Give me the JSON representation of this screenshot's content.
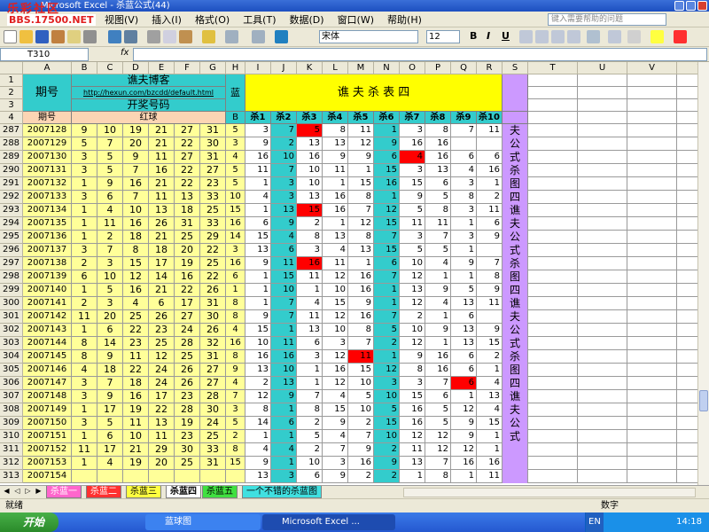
{
  "app": {
    "title": "Microsoft Excel - 杀蓝公式(44)",
    "watermark1": "乐彩社区",
    "watermark2": "BBS.17500.NET"
  },
  "menu": [
    "视图(V)",
    "插入(I)",
    "格式(O)",
    "工具(T)",
    "数据(D)",
    "窗口(W)",
    "帮助(H)"
  ],
  "help_placeholder": "键入需要帮助的问题",
  "toolbar": {
    "font": "宋体",
    "size": "12",
    "bold": "B",
    "italic": "I",
    "underline": "U"
  },
  "formula": {
    "cell_ref": "T310",
    "fx": "fx"
  },
  "columns": [
    "A",
    "B",
    "C",
    "D",
    "E",
    "F",
    "G",
    "H",
    "I",
    "J",
    "K",
    "L",
    "M",
    "N",
    "O",
    "P",
    "Q",
    "R",
    "S",
    "T",
    "U",
    "V",
    "W"
  ],
  "header": {
    "period": "期号",
    "blog": "谯夫博客",
    "url": "http://hexun.com/bzcdd/default.html",
    "draw": "开奖号码",
    "red": "红球",
    "blue_label": "蓝号",
    "blue_b": "B",
    "table_title": "谯 夫 杀 表 四",
    "kill_headers": [
      "杀1",
      "杀2",
      "杀3",
      "杀4",
      "杀5",
      "杀6",
      "杀7",
      "杀8",
      "杀9",
      "杀10"
    ]
  },
  "rows": [
    {
      "n": "287",
      "id": "2007128",
      "r": [
        "9",
        "10",
        "19",
        "21",
        "27",
        "31"
      ],
      "b": "5",
      "k": [
        "3",
        "7",
        "5",
        "8",
        "11",
        "1",
        "3",
        "8",
        "7",
        "11"
      ]
    },
    {
      "n": "288",
      "id": "2007129",
      "r": [
        "5",
        "7",
        "20",
        "21",
        "22",
        "30"
      ],
      "b": "3",
      "k": [
        "9",
        "2",
        "13",
        "13",
        "12",
        "9",
        "16",
        "16",
        "",
        ""
      ]
    },
    {
      "n": "289",
      "id": "2007130",
      "r": [
        "3",
        "5",
        "9",
        "11",
        "27",
        "31"
      ],
      "b": "4",
      "k": [
        "16",
        "10",
        "16",
        "9",
        "9",
        "6",
        "4",
        "16",
        "6",
        "6"
      ]
    },
    {
      "n": "290",
      "id": "2007131",
      "r": [
        "3",
        "5",
        "7",
        "16",
        "22",
        "27"
      ],
      "b": "5",
      "k": [
        "11",
        "7",
        "10",
        "11",
        "1",
        "15",
        "3",
        "13",
        "4",
        "16"
      ]
    },
    {
      "n": "291",
      "id": "2007132",
      "r": [
        "1",
        "9",
        "16",
        "21",
        "22",
        "23"
      ],
      "b": "5",
      "k": [
        "1",
        "3",
        "10",
        "1",
        "15",
        "16",
        "15",
        "6",
        "3",
        "1"
      ]
    },
    {
      "n": "292",
      "id": "2007133",
      "r": [
        "3",
        "6",
        "7",
        "11",
        "13",
        "33"
      ],
      "b": "10",
      "k": [
        "4",
        "3",
        "13",
        "16",
        "8",
        "1",
        "9",
        "5",
        "8",
        "2"
      ]
    },
    {
      "n": "293",
      "id": "2007134",
      "r": [
        "1",
        "4",
        "10",
        "13",
        "18",
        "25"
      ],
      "b": "15",
      "k": [
        "1",
        "13",
        "15",
        "16",
        "7",
        "12",
        "5",
        "8",
        "3",
        "11"
      ]
    },
    {
      "n": "294",
      "id": "2007135",
      "r": [
        "1",
        "11",
        "16",
        "26",
        "31",
        "33"
      ],
      "b": "16",
      "k": [
        "6",
        "9",
        "2",
        "1",
        "12",
        "15",
        "11",
        "11",
        "1",
        "6"
      ]
    },
    {
      "n": "295",
      "id": "2007136",
      "r": [
        "1",
        "2",
        "18",
        "21",
        "25",
        "29"
      ],
      "b": "14",
      "k": [
        "15",
        "4",
        "8",
        "13",
        "8",
        "7",
        "3",
        "7",
        "3",
        "9"
      ]
    },
    {
      "n": "296",
      "id": "2007137",
      "r": [
        "3",
        "7",
        "8",
        "18",
        "20",
        "22"
      ],
      "b": "3",
      "k": [
        "13",
        "6",
        "3",
        "4",
        "13",
        "15",
        "5",
        "5",
        "1",
        ""
      ]
    },
    {
      "n": "297",
      "id": "2007138",
      "r": [
        "2",
        "3",
        "15",
        "17",
        "19",
        "25"
      ],
      "b": "16",
      "k": [
        "9",
        "11",
        "16",
        "11",
        "1",
        "6",
        "10",
        "4",
        "9",
        "7"
      ]
    },
    {
      "n": "298",
      "id": "2007139",
      "r": [
        "6",
        "10",
        "12",
        "14",
        "16",
        "22"
      ],
      "b": "6",
      "k": [
        "1",
        "15",
        "11",
        "12",
        "16",
        "7",
        "12",
        "1",
        "1",
        "8"
      ]
    },
    {
      "n": "299",
      "id": "2007140",
      "r": [
        "1",
        "5",
        "16",
        "21",
        "22",
        "26"
      ],
      "b": "1",
      "k": [
        "1",
        "10",
        "1",
        "10",
        "16",
        "1",
        "13",
        "9",
        "5",
        "9"
      ]
    },
    {
      "n": "300",
      "id": "2007141",
      "r": [
        "2",
        "3",
        "4",
        "6",
        "17",
        "31"
      ],
      "b": "8",
      "k": [
        "1",
        "7",
        "4",
        "15",
        "9",
        "1",
        "12",
        "4",
        "13",
        "11"
      ]
    },
    {
      "n": "301",
      "id": "2007142",
      "r": [
        "11",
        "20",
        "25",
        "26",
        "27",
        "30"
      ],
      "b": "8",
      "k": [
        "9",
        "7",
        "11",
        "12",
        "16",
        "7",
        "2",
        "1",
        "6",
        ""
      ]
    },
    {
      "n": "302",
      "id": "2007143",
      "r": [
        "1",
        "6",
        "22",
        "23",
        "24",
        "26"
      ],
      "b": "4",
      "k": [
        "15",
        "1",
        "13",
        "10",
        "8",
        "5",
        "10",
        "9",
        "13",
        "9"
      ]
    },
    {
      "n": "303",
      "id": "2007144",
      "r": [
        "8",
        "14",
        "23",
        "25",
        "28",
        "32"
      ],
      "b": "16",
      "k": [
        "10",
        "11",
        "6",
        "3",
        "7",
        "2",
        "12",
        "1",
        "13",
        "15"
      ]
    },
    {
      "n": "304",
      "id": "2007145",
      "r": [
        "8",
        "9",
        "11",
        "12",
        "25",
        "31"
      ],
      "b": "8",
      "k": [
        "16",
        "16",
        "3",
        "12",
        "11",
        "1",
        "9",
        "16",
        "6",
        "2"
      ]
    },
    {
      "n": "305",
      "id": "2007146",
      "r": [
        "4",
        "18",
        "22",
        "24",
        "26",
        "27"
      ],
      "b": "9",
      "k": [
        "13",
        "10",
        "1",
        "16",
        "15",
        "12",
        "8",
        "16",
        "6",
        "1"
      ]
    },
    {
      "n": "306",
      "id": "2007147",
      "r": [
        "3",
        "7",
        "18",
        "24",
        "26",
        "27"
      ],
      "b": "4",
      "k": [
        "2",
        "13",
        "1",
        "12",
        "10",
        "3",
        "3",
        "7",
        "6",
        "4"
      ]
    },
    {
      "n": "307",
      "id": "2007148",
      "r": [
        "3",
        "9",
        "16",
        "17",
        "23",
        "28"
      ],
      "b": "7",
      "k": [
        "12",
        "9",
        "7",
        "4",
        "5",
        "10",
        "15",
        "6",
        "1",
        "13"
      ]
    },
    {
      "n": "308",
      "id": "2007149",
      "r": [
        "1",
        "17",
        "19",
        "22",
        "28",
        "30"
      ],
      "b": "3",
      "k": [
        "8",
        "1",
        "8",
        "15",
        "10",
        "5",
        "16",
        "5",
        "12",
        "4"
      ]
    },
    {
      "n": "309",
      "id": "2007150",
      "r": [
        "3",
        "5",
        "11",
        "13",
        "19",
        "24"
      ],
      "b": "5",
      "k": [
        "14",
        "6",
        "2",
        "9",
        "2",
        "15",
        "16",
        "5",
        "9",
        "15"
      ]
    },
    {
      "n": "310",
      "id": "2007151",
      "r": [
        "1",
        "6",
        "10",
        "11",
        "23",
        "25"
      ],
      "b": "2",
      "k": [
        "1",
        "1",
        "5",
        "4",
        "7",
        "10",
        "12",
        "12",
        "9",
        "1"
      ]
    },
    {
      "n": "311",
      "id": "2007152",
      "r": [
        "11",
        "17",
        "21",
        "29",
        "30",
        "33"
      ],
      "b": "8",
      "k": [
        "4",
        "4",
        "2",
        "7",
        "9",
        "2",
        "11",
        "12",
        "12",
        "1"
      ]
    },
    {
      "n": "312",
      "id": "2007153",
      "r": [
        "1",
        "4",
        "19",
        "20",
        "25",
        "31"
      ],
      "b": "15",
      "k": [
        "9",
        "1",
        "10",
        "3",
        "16",
        "9",
        "13",
        "7",
        "16",
        "16"
      ]
    },
    {
      "n": "313",
      "id": "2007154",
      "r": [
        "",
        "",
        "",
        "",
        "",
        ""
      ],
      "b": "",
      "k": [
        "13",
        "3",
        "6",
        "9",
        "2",
        "2",
        "1",
        "8",
        "1",
        "11"
      ]
    }
  ],
  "side_text": "夫公式杀图四 谯夫公式杀图四 谯夫公式杀图四 谯夫公式",
  "tabs": [
    "杀蓝一",
    "杀蓝二",
    "杀蓝三",
    "杀蓝四",
    "杀蓝五",
    "一个不错的杀蓝图"
  ],
  "active_tab": "杀蓝四",
  "status": {
    "left": "就绪",
    "right": "数字"
  },
  "taskbar": {
    "start": "开始",
    "task1": "蓝球图",
    "task2": "Microsoft Excel ...",
    "lang": "EN",
    "time": "14:18"
  },
  "red_cells": [
    [
      0,
      2
    ],
    [
      2,
      6
    ],
    [
      6,
      2
    ],
    [
      10,
      2
    ],
    [
      17,
      4
    ],
    [
      19,
      8
    ]
  ],
  "colors": {
    "yellow": "#ffff99",
    "cyan": "#33cccc",
    "peach": "#fcd5b4",
    "lilac": "#cc99ff",
    "red": "#ff0000",
    "title_yellow": "#ffff00"
  }
}
